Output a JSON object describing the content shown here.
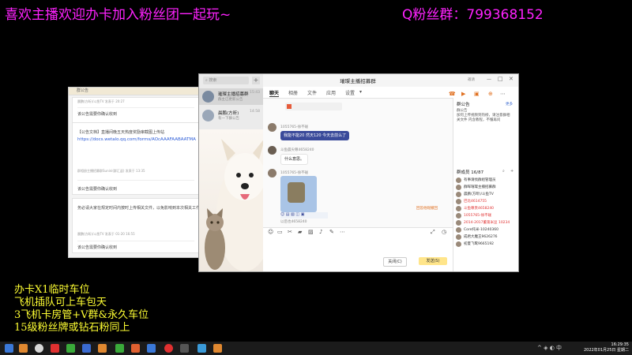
{
  "overlay": {
    "left_banner": "喜欢主播欢迎办卡加入粉丝团一起玩~",
    "right_banner": "Q粉丝群：799368152",
    "promo_lines": [
      "办卡X1临时车位",
      "飞机插队可上车包天",
      "3飞机卡房管+V群&永久车位",
      "15级粉丝牌或钻石粉同上"
    ]
  },
  "notice_window": {
    "title": "群公告",
    "cards": [
      {
        "meta": "晨鹏(方昕)/斗鱼TV  发表于 20:27",
        "status": "该公告需要你确认收到"
      },
      {
        "text": "【公告文档】直播间晚五天热度奖励审截图上传站",
        "link": "https://docs.wetalo.qq.com/forms/AOcAAAFAABAATMA",
        "meta": "群相册主播招募群Sunini(群汇返)  发表于 13:35",
        "status": "该公告需要你确认收到"
      },
      {
        "text": "务必请大家在规定时间内按时上传相关文件，以免影响到本次相关工作",
        "meta": "晨鹏(方昕)/斗鱼TV  发表于 01-20 16:55",
        "status": "该公告需要你确认收到"
      }
    ]
  },
  "chat_window": {
    "search_placeholder": "搜索",
    "conversations": [
      {
        "name": "璀璨主播招募群",
        "sub": "群主已更新公告",
        "time": "15:43"
      },
      {
        "name": "晨鹏(方昕)",
        "sub": "有一下群公告",
        "time": "14:58"
      }
    ],
    "title": "璀璨主播招募群",
    "top_right": "邀请",
    "tabs": [
      "聊天",
      "相册",
      "文件",
      "应用",
      "设置"
    ],
    "messages": [
      {
        "name": "1055765-徐不碰",
        "text": "我能不能20 然天120 今天去前么了"
      },
      {
        "name": "斗鱼晨尖尊4658240",
        "text": "什么意思。"
      },
      {
        "name": "1055765-徐不碰",
        "text": "",
        "sticker": true
      }
    ],
    "input_hint": "以后也4658240",
    "recall_hint": "回答他呢撤回",
    "buttons": {
      "close": "关闭(C)",
      "send": "发送(S)"
    },
    "right_panel": {
      "notice_title": "群公告",
      "more": "更多",
      "notice_body": [
        "群公告",
        "加何上传视频到热榜，请注意群相",
        "关文件 内含教程，不懂再问"
      ],
      "members_title": "群成员 16/87",
      "members": [
        {
          "name": "有事请找群组管理员",
          "color": "#333333"
        },
        {
          "name": "群晖璀璨主播招募群",
          "color": "#333333"
        },
        {
          "name": "晨鹏(方昕)/斗鱼TV",
          "color": "#333333"
        },
        {
          "name": "巴比4614755",
          "color": "#e03030"
        },
        {
          "name": "斗鱼尊贵4658240",
          "color": "#e03030"
        },
        {
          "name": "1055765-徐不碰",
          "color": "#e03030"
        },
        {
          "name": "2014-2017董第米豆 10234",
          "color": "#e03030"
        },
        {
          "name": "Core托米-10240360",
          "color": "#333333"
        },
        {
          "name": "成君大魔王9626276",
          "color": "#333333"
        },
        {
          "name": "初夏飞鹭9665192",
          "color": "#333333"
        }
      ]
    }
  },
  "taskbar": {
    "time": "16:29:35",
    "date": "2022年01月25日 星期二"
  }
}
